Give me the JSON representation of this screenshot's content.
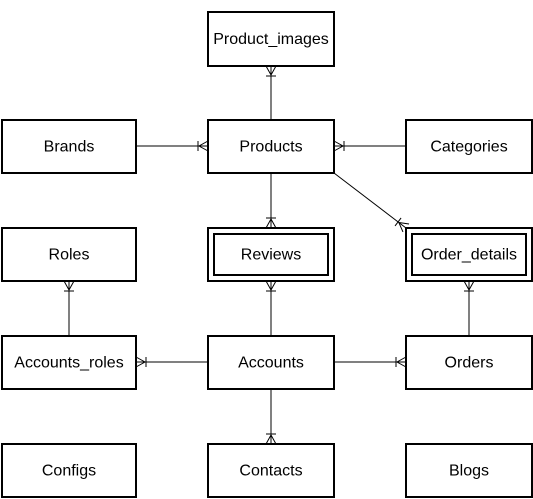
{
  "diagram": {
    "entities": [
      {
        "id": "product_images",
        "label": "Product_images",
        "weak": false
      },
      {
        "id": "brands",
        "label": "Brands",
        "weak": false
      },
      {
        "id": "products",
        "label": "Products",
        "weak": false
      },
      {
        "id": "categories",
        "label": "Categories",
        "weak": false
      },
      {
        "id": "roles",
        "label": "Roles",
        "weak": false
      },
      {
        "id": "reviews",
        "label": "Reviews",
        "weak": true
      },
      {
        "id": "order_details",
        "label": "Order_details",
        "weak": true
      },
      {
        "id": "accounts_roles",
        "label": "Accounts_roles",
        "weak": false
      },
      {
        "id": "accounts",
        "label": "Accounts",
        "weak": false
      },
      {
        "id": "orders",
        "label": "Orders",
        "weak": false
      },
      {
        "id": "configs",
        "label": "Configs",
        "weak": false
      },
      {
        "id": "contacts",
        "label": "Contacts",
        "weak": false
      },
      {
        "id": "blogs",
        "label": "Blogs",
        "weak": false
      }
    ],
    "relationships": [
      {
        "from": "products",
        "to": "product_images",
        "cardinality": "one-to-many"
      },
      {
        "from": "brands",
        "to": "products",
        "cardinality": "one-to-many"
      },
      {
        "from": "categories",
        "to": "products",
        "cardinality": "one-to-many"
      },
      {
        "from": "products",
        "to": "reviews",
        "cardinality": "one-to-many"
      },
      {
        "from": "products",
        "to": "order_details",
        "cardinality": "one-to-many"
      },
      {
        "from": "accounts_roles",
        "to": "roles",
        "cardinality": "one-to-many"
      },
      {
        "from": "accounts",
        "to": "reviews",
        "cardinality": "one-to-many"
      },
      {
        "from": "orders",
        "to": "order_details",
        "cardinality": "one-to-many"
      },
      {
        "from": "accounts",
        "to": "accounts_roles",
        "cardinality": "one-to-many"
      },
      {
        "from": "accounts",
        "to": "orders",
        "cardinality": "one-to-many"
      },
      {
        "from": "accounts",
        "to": "contacts",
        "cardinality": "one-to-many"
      }
    ],
    "colors": {
      "stroke": "#000000",
      "fill": "#ffffff",
      "text": "#000000"
    }
  }
}
